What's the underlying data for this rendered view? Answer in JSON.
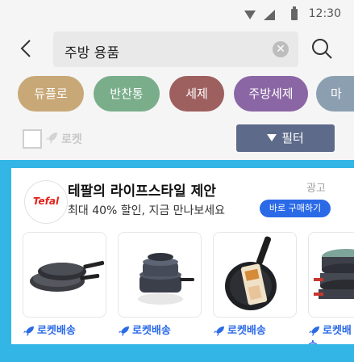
{
  "status_bar": {
    "time": "12:30"
  },
  "search": {
    "query": "주방 용품"
  },
  "chips": [
    {
      "label": "듀플로",
      "color": "#c8a877"
    },
    {
      "label": "반찬통",
      "color": "#7aae8b"
    },
    {
      "label": "세제",
      "color": "#9e5f5f"
    },
    {
      "label": "주방세제",
      "color": "#8b66a5"
    },
    {
      "label": "마",
      "color": "#8b9fb1"
    }
  ],
  "filter_row": {
    "rocket_label": "로켓",
    "filter_label": "필터"
  },
  "ad": {
    "brand": "Tefal",
    "title": "테팔의 라이프스타일 제안",
    "subtitle": "최대 40% 할인, 지금 만나보세요",
    "tag": "광고",
    "cta": "바로 구매하기",
    "delivery_label": "로켓배송",
    "products": [
      {
        "name": "frying-pan-set"
      },
      {
        "name": "cookware-stack"
      },
      {
        "name": "frying-pan"
      },
      {
        "name": "pot-set"
      }
    ]
  },
  "colors": {
    "background": "#f5f5f5",
    "ad_background": "#33b5e5",
    "filter_button": "#5d6a89",
    "rocket_blue": "#2b6ae7",
    "brand_red": "#e2231a"
  }
}
